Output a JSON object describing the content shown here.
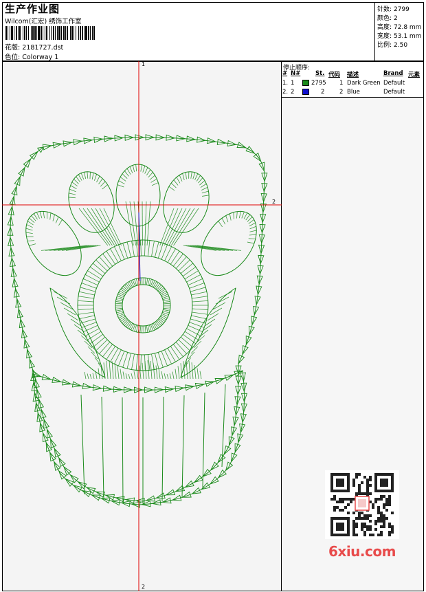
{
  "header": {
    "title": "生产作业图",
    "subtitle": "Wilcom(汇宏) 绣饰工作室",
    "design_label": "花版:",
    "design_file": "2181727.dst",
    "colorway_label": "色位:",
    "colorway_value": "Colorway 1"
  },
  "stats": [
    {
      "label": "针数:",
      "value": "2799"
    },
    {
      "label": "颜色:",
      "value": "2"
    },
    {
      "label": "高度:",
      "value": "72.8 mm"
    },
    {
      "label": "宽度:",
      "value": "53.1 mm"
    },
    {
      "label": "比例:",
      "value": "2.50"
    }
  ],
  "stop_sequence": {
    "title": "停止顺序:",
    "columns": [
      "#",
      "N#",
      "St.",
      "代码",
      "描述",
      "Brand",
      "元素"
    ],
    "rows": [
      {
        "index": "1.",
        "n": "1",
        "color": "#1a8a1a",
        "stitches": "2795",
        "code": "1",
        "description": "Dark Green",
        "brand": "Default"
      },
      {
        "index": "2.",
        "n": "2",
        "color": "#1010d0",
        "stitches": "2",
        "code": "2",
        "description": "Blue",
        "brand": "Default"
      }
    ]
  },
  "axis_labels": {
    "top": "1",
    "bottom": "2",
    "right": "2"
  },
  "watermark": "6xiu.com",
  "colors": {
    "stitch": "#1a8a1a",
    "crosshair": "#e00000",
    "accent": "#1010d0"
  }
}
